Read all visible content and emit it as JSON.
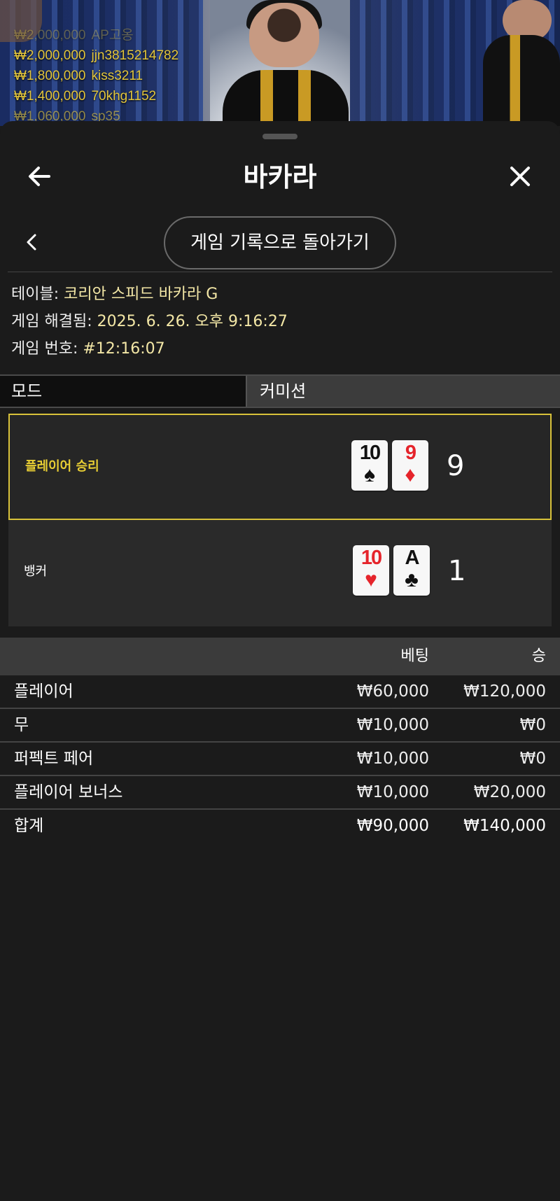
{
  "video": {
    "ticker": [
      {
        "amount": "₩2,000,000",
        "user": "AP고옹"
      },
      {
        "amount": "₩2,000,000",
        "user": "jjn3815214782"
      },
      {
        "amount": "₩1,800,000",
        "user": "kiss3211"
      },
      {
        "amount": "₩1,400,000",
        "user": "70khg1152"
      },
      {
        "amount": "₩1,060,000",
        "user": "sp35"
      }
    ]
  },
  "header": {
    "title": "바카라",
    "back_icon": "arrow-left-icon",
    "close_icon": "close-icon"
  },
  "subnav": {
    "chevron_icon": "chevron-left-icon",
    "history_button": "게임 기록으로 돌아가기"
  },
  "info": {
    "table_label": "테이블:",
    "table_value": "코리안 스피드 바카라 G",
    "resolved_label": "게임 해결됨:",
    "resolved_value": "2025. 6. 26. 오후 9:16:27",
    "number_label": "게임 번호:",
    "number_value": "#12:16:07"
  },
  "tabs": {
    "mode": "모드",
    "commission": "커미션"
  },
  "hands": {
    "player": {
      "label": "플레이어 승리",
      "cards": [
        {
          "rank": "10",
          "suit": "♠",
          "color": "black"
        },
        {
          "rank": "9",
          "suit": "♦",
          "color": "red"
        }
      ],
      "score": "9"
    },
    "banker": {
      "label": "뱅커",
      "cards": [
        {
          "rank": "10",
          "suit": "♥",
          "color": "red"
        },
        {
          "rank": "A",
          "suit": "♣",
          "color": "black"
        }
      ],
      "score": "1"
    }
  },
  "bets": {
    "header": {
      "bet": "베팅",
      "win": "승"
    },
    "rows": [
      {
        "name": "플레이어",
        "bet": "₩60,000",
        "win": "₩120,000"
      },
      {
        "name": "무",
        "bet": "₩10,000",
        "win": "₩0"
      },
      {
        "name": "퍼펙트 페어",
        "bet": "₩10,000",
        "win": "₩0"
      },
      {
        "name": "플레이어 보너스",
        "bet": "₩10,000",
        "win": "₩20,000"
      }
    ],
    "total": {
      "name": "합계",
      "bet": "₩90,000",
      "win": "₩140,000"
    }
  },
  "colors": {
    "accent": "#d8c23a",
    "card_red": "#e5242b",
    "background": "#1b1b1b"
  }
}
